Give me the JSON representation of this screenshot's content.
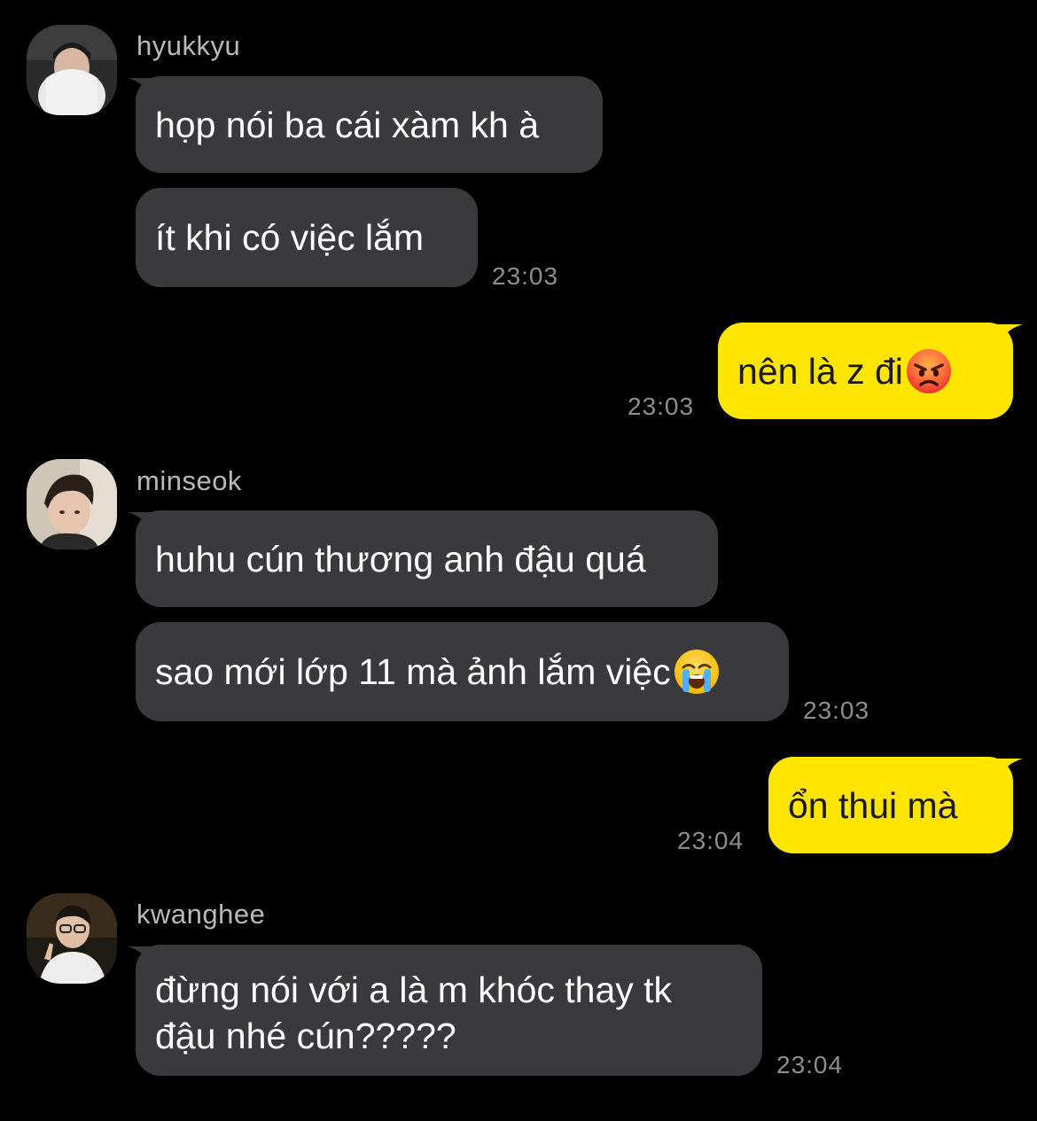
{
  "chat": {
    "groups": [
      {
        "sender": "hyukkyu",
        "messages": [
          "họp nói ba cái xàm kh à",
          "ít khi có việc lắm"
        ],
        "time": "23:03"
      },
      {
        "outgoing": {
          "text": "nên là z đi",
          "emoji": "angry-face-emoji",
          "time": "23:03"
        }
      },
      {
        "sender": "minseok",
        "messages": [
          "huhu cún thương anh đậu quá",
          "sao mới lớp 11 mà ảnh lắm việc"
        ],
        "emoji": "loudly-crying-face-emoji",
        "time": "23:03"
      },
      {
        "outgoing": {
          "text": "ổn thui mà",
          "time": "23:04"
        }
      },
      {
        "sender": "kwanghee",
        "messages": [
          "đừng nói với a là m khóc thay tk đậu nhé cún?????"
        ],
        "time": "23:04"
      }
    ]
  },
  "colors": {
    "background": "#000000",
    "incoming_bubble": "#3a3a3c",
    "outgoing_bubble": "#fee500",
    "sender_name": "#b9b9b9",
    "timestamp": "#8e8e8e"
  }
}
